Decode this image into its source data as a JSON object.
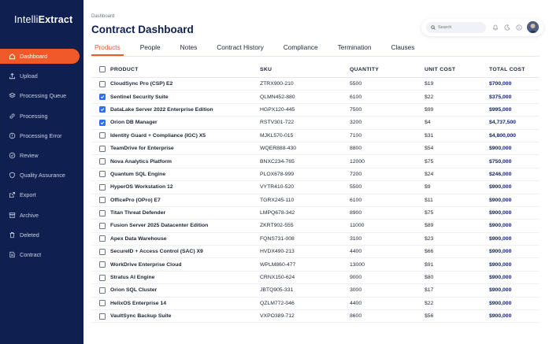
{
  "app": {
    "logo_light": "Intelli",
    "logo_bold": "Extract"
  },
  "sidebar": {
    "items": [
      {
        "label": "Dashboard",
        "icon": "home-icon",
        "active": true
      },
      {
        "label": "Upload",
        "icon": "upload-icon",
        "active": false
      },
      {
        "label": "Processing Queue",
        "icon": "layers-icon",
        "active": false
      },
      {
        "label": "Processing",
        "icon": "link-icon",
        "active": false
      },
      {
        "label": "Processing Error",
        "icon": "error-icon",
        "active": false
      },
      {
        "label": "Review",
        "icon": "review-icon",
        "active": false
      },
      {
        "label": "Quality Assurance",
        "icon": "quality-icon",
        "active": false
      },
      {
        "label": "Export",
        "icon": "export-icon",
        "active": false
      },
      {
        "label": "Archive",
        "icon": "archive-icon",
        "active": false
      },
      {
        "label": "Deleted",
        "icon": "trash-icon",
        "active": false
      },
      {
        "label": "Contract",
        "icon": "contract-icon",
        "active": false
      }
    ]
  },
  "header": {
    "breadcrumb": "Dashboard",
    "title": "Contract Dashboard",
    "search_placeholder": "Search"
  },
  "tabs": [
    {
      "label": "Products",
      "active": true
    },
    {
      "label": "People",
      "active": false
    },
    {
      "label": "Notes",
      "active": false
    },
    {
      "label": "Contract History",
      "active": false
    },
    {
      "label": "Compliance",
      "active": false
    },
    {
      "label": "Termination",
      "active": false
    },
    {
      "label": "Clauses",
      "active": false
    }
  ],
  "table": {
    "columns": {
      "product": "PRODUCT",
      "sku": "SKU",
      "quantity": "QUANTITY",
      "unit_cost": "UNIT COST",
      "total_cost": "TOTAL COST"
    },
    "rows": [
      {
        "product": "CloudSync Pro (CSP) E2",
        "sku": "ZTRX900-210",
        "quantity": "5500",
        "unit_cost": "$19",
        "total_cost": "$700,000",
        "checked": false
      },
      {
        "product": "Sentinel Security Suite",
        "sku": "QLMN452-880",
        "quantity": "6100",
        "unit_cost": "$22",
        "total_cost": "$375,000",
        "checked": true
      },
      {
        "product": "DataLake Server 2022 Enterprise Edition",
        "sku": "HGPX120-445",
        "quantity": "7500",
        "unit_cost": "$99",
        "total_cost": "$995,000",
        "checked": true
      },
      {
        "product": "Orion DB Manager",
        "sku": "RSTV301-722",
        "quantity": "3200",
        "unit_cost": "$4",
        "total_cost": "$4,737,500",
        "checked": true
      },
      {
        "product": "Identity Guard + Compliance (IGC) X5",
        "sku": "MJKL570-015",
        "quantity": "7100",
        "unit_cost": "$31",
        "total_cost": "$4,800,000",
        "checked": false
      },
      {
        "product": "TeamDrive for Enterprise",
        "sku": "WQER888-430",
        "quantity": "8800",
        "unit_cost": "$54",
        "total_cost": "$900,000",
        "checked": false
      },
      {
        "product": "Nova Analytics Platform",
        "sku": "BNXC234-765",
        "quantity": "12000",
        "unit_cost": "$75",
        "total_cost": "$750,000",
        "checked": false
      },
      {
        "product": "Quantum SQL Engine",
        "sku": "PLOX678-999",
        "quantity": "7200",
        "unit_cost": "$24",
        "total_cost": "$246,000",
        "checked": false
      },
      {
        "product": "HyperOS Workstation 12",
        "sku": "VYTR410-520",
        "quantity": "5500",
        "unit_cost": "$9",
        "total_cost": "$900,000",
        "checked": false
      },
      {
        "product": "OfficePro (OPro) E7",
        "sku": "TGRX245-110",
        "quantity": "6100",
        "unit_cost": "$11",
        "total_cost": "$900,000",
        "checked": false
      },
      {
        "product": "Titan Threat Defender",
        "sku": "LMPQ678-342",
        "quantity": "8900",
        "unit_cost": "$75",
        "total_cost": "$900,000",
        "checked": false
      },
      {
        "product": "Fusion Server 2025 Datacenter Edition",
        "sku": "ZKRT902-555",
        "quantity": "11000",
        "unit_cost": "$89",
        "total_cost": "$900,000",
        "checked": false
      },
      {
        "product": "Apex Data Warehouse",
        "sku": "FQNS731-008",
        "quantity": "3100",
        "unit_cost": "$23",
        "total_cost": "$900,000",
        "checked": false
      },
      {
        "product": "SecureID + Access Control (SAC) X9",
        "sku": "HVDX490-213",
        "quantity": "4400",
        "unit_cost": "$66",
        "total_cost": "$900,000",
        "checked": false
      },
      {
        "product": "WorkDrive Enterprise Cloud",
        "sku": "WPLM860-477",
        "quantity": "13000",
        "unit_cost": "$91",
        "total_cost": "$900,000",
        "checked": false
      },
      {
        "product": "Stratus AI Engine",
        "sku": "CRNX150-624",
        "quantity": "9000",
        "unit_cost": "$80",
        "total_cost": "$900,000",
        "checked": false
      },
      {
        "product": "Orion SQL Cluster",
        "sku": "JBTQ905-331",
        "quantity": "3000",
        "unit_cost": "$17",
        "total_cost": "$900,000",
        "checked": false
      },
      {
        "product": "HelixOS Enterprise 14",
        "sku": "QZLM772-046",
        "quantity": "4400",
        "unit_cost": "$22",
        "total_cost": "$900,000",
        "checked": false
      },
      {
        "product": "VaultSync Backup Suite",
        "sku": "VXPO389-712",
        "quantity": "8600",
        "unit_cost": "$56",
        "total_cost": "$900,000",
        "checked": false
      }
    ]
  },
  "colors": {
    "sidebar": "#0f1f4f",
    "accent": "#f05a28",
    "checkbox": "#2d6ff0",
    "total": "#0f1f6e"
  }
}
